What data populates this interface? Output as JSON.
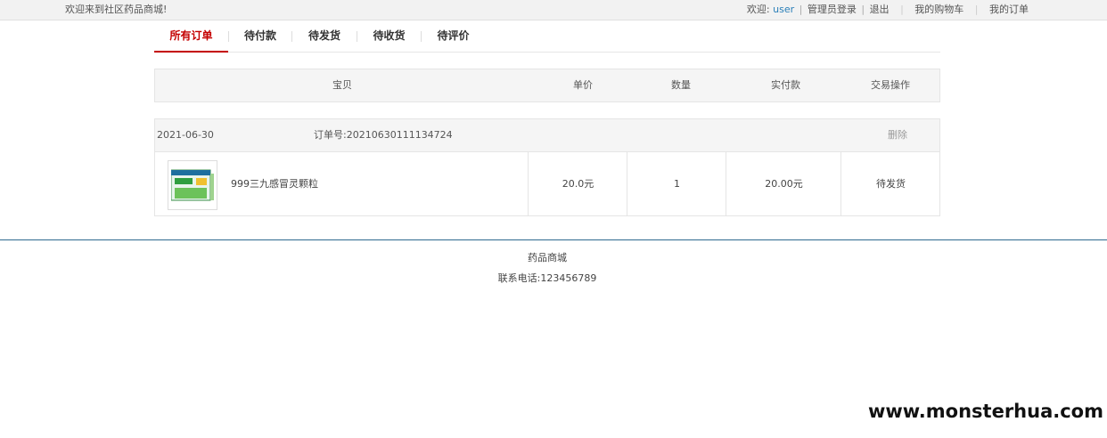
{
  "topbar": {
    "welcome": "欢迎来到社区药品商城!",
    "hello": "欢迎:",
    "username": "user",
    "admin_login": "管理员登录",
    "logout": "退出",
    "cart": "我的购物车",
    "orders": "我的订单"
  },
  "tabs": [
    "所有订单",
    "待付款",
    "待发货",
    "待收货",
    "待评价"
  ],
  "active_tab": "所有订单",
  "table_header": {
    "item": "宝贝",
    "price": "单价",
    "qty": "数量",
    "paid": "实付款",
    "action": "交易操作"
  },
  "order": {
    "date": "2021-06-30",
    "order_no": "订单号:20210630111134724",
    "delete": "删除",
    "product_name": "999三九感冒灵颗粒",
    "unit_price": "20.0元",
    "quantity": "1",
    "paid_amount": "20.00元",
    "status": "待发货"
  },
  "footer": {
    "name": "药品商城",
    "phone": "联系电话:123456789"
  },
  "watermark": "www.monsterhua.com",
  "colors": {
    "accent": "#c40000",
    "link": "#2a7fb8",
    "footer_line": "#2e6a8f"
  }
}
